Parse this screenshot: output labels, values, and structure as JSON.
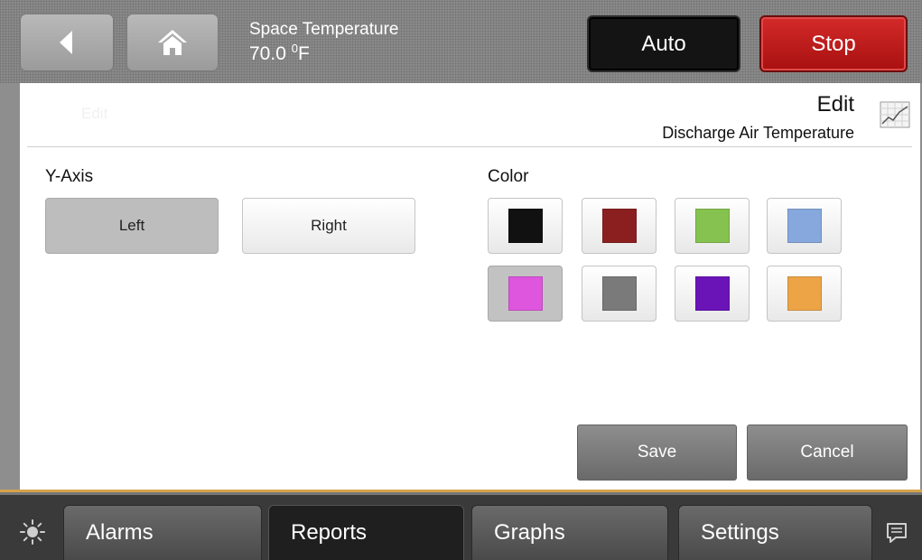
{
  "header": {
    "space_temp_label": "Space Temperature",
    "space_temp_value": "70.0",
    "space_temp_unit_sup": "0",
    "space_temp_unit": "F",
    "auto_label": "Auto",
    "stop_label": "Stop"
  },
  "panel": {
    "ghost_title": "Edit",
    "title": "Edit",
    "subtitle": "Discharge Air Temperature",
    "yaxis_label": "Y-Axis",
    "yaxis_options": [
      "Left",
      "Right"
    ],
    "yaxis_selected": "Left",
    "color_label": "Color",
    "colors": [
      "#111111",
      "#8b1f1f",
      "#86c24f",
      "#86a8dc",
      "#de56de",
      "#7a7a7a",
      "#6a14b8",
      "#eca447"
    ],
    "selected_color_index": 4,
    "save_label": "Save",
    "cancel_label": "Cancel"
  },
  "nav": {
    "items": [
      {
        "label": "Alarms"
      },
      {
        "label": "Reports"
      },
      {
        "label": "Graphs"
      },
      {
        "label": "Settings"
      }
    ],
    "active": "Reports"
  },
  "icons": {
    "back": "back-arrow-icon",
    "home": "home-icon",
    "graph": "graph-icon",
    "sun": "sun-icon",
    "message": "message-icon"
  }
}
